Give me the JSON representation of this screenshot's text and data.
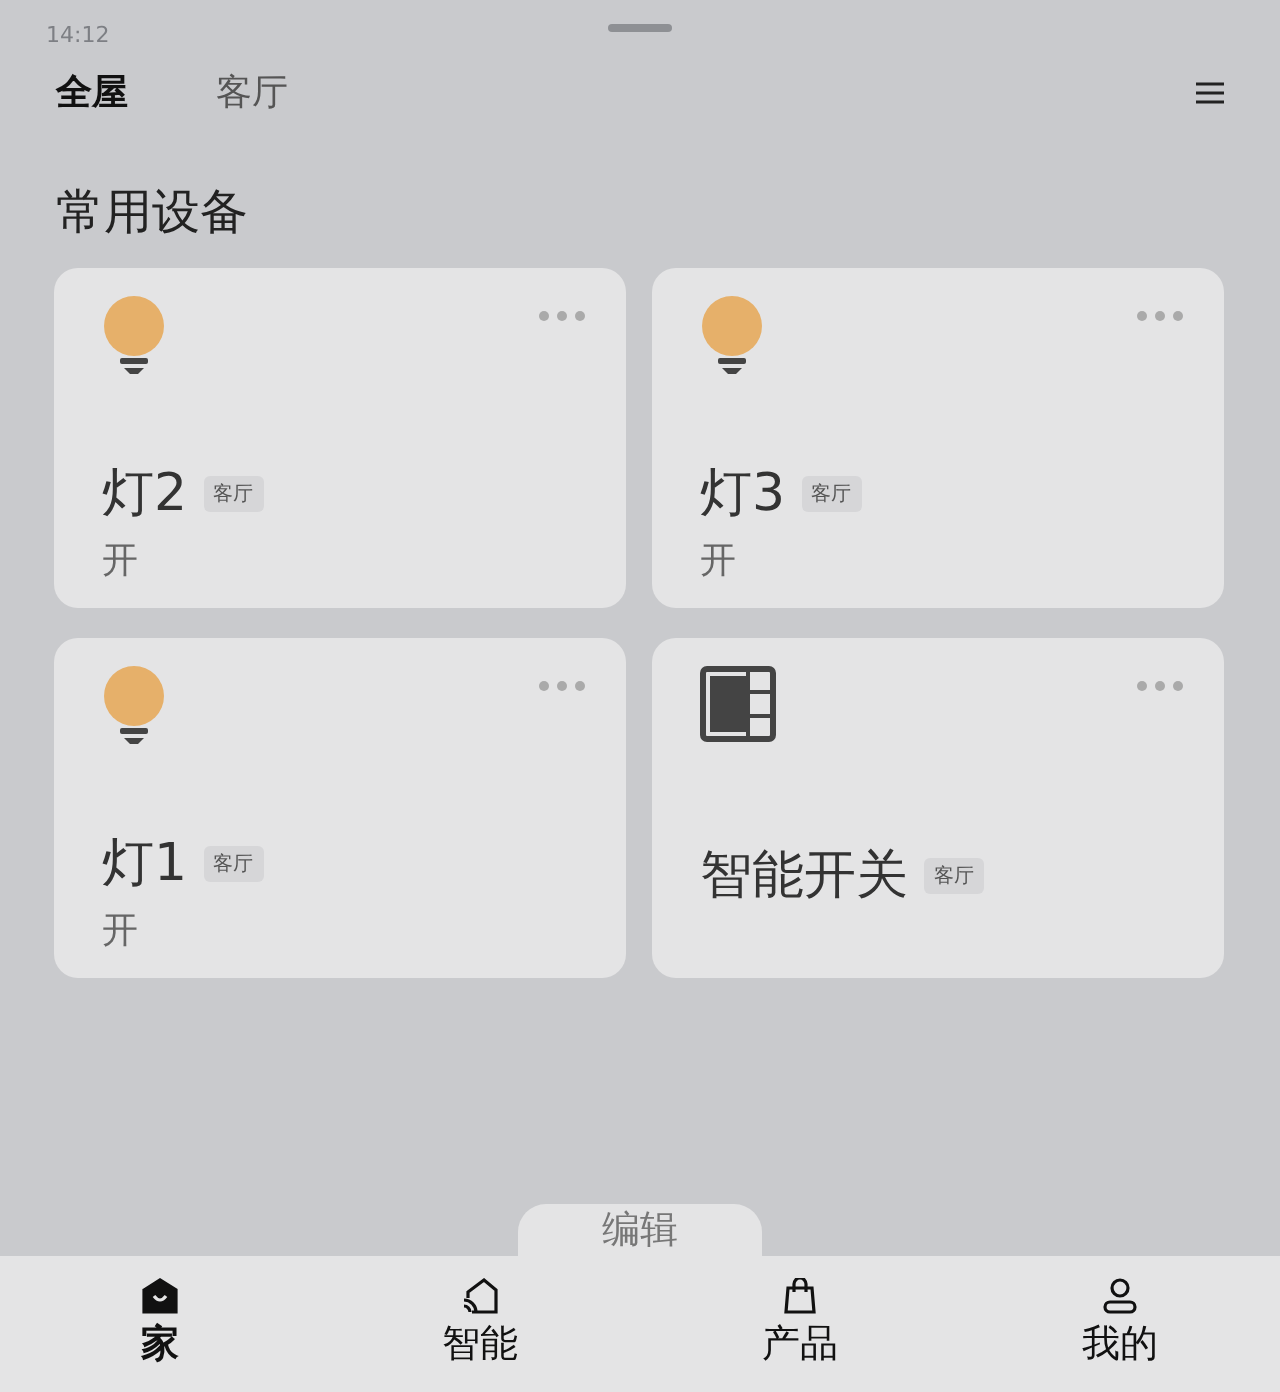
{
  "status_bar": {
    "time": "14:12"
  },
  "tabs": [
    {
      "label": "全屋",
      "selected": true
    },
    {
      "label": "客厅",
      "selected": false
    }
  ],
  "section_title": "常用设备",
  "devices": [
    {
      "kind": "light",
      "name": "灯2",
      "room": "客厅",
      "state": "开"
    },
    {
      "kind": "light",
      "name": "灯3",
      "room": "客厅",
      "state": "开"
    },
    {
      "kind": "light",
      "name": "灯1",
      "room": "客厅",
      "state": "开"
    },
    {
      "kind": "switch",
      "name": "智能开关",
      "room": "客厅"
    }
  ],
  "edit_button": "编辑",
  "nav": [
    {
      "kind": "home",
      "label": "家",
      "selected": true
    },
    {
      "kind": "smart",
      "label": "智能",
      "selected": false
    },
    {
      "kind": "product",
      "label": "产品",
      "selected": false
    },
    {
      "kind": "profile",
      "label": "我的",
      "selected": false
    }
  ]
}
